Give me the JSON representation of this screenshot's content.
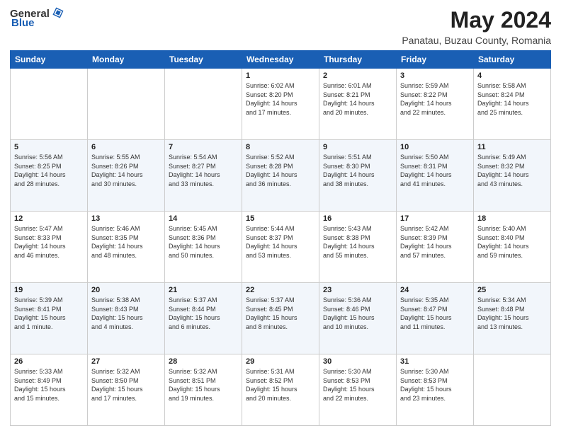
{
  "header": {
    "logo_general": "General",
    "logo_blue": "Blue",
    "title": "May 2024",
    "location": "Panatau, Buzau County, Romania"
  },
  "days_of_week": [
    "Sunday",
    "Monday",
    "Tuesday",
    "Wednesday",
    "Thursday",
    "Friday",
    "Saturday"
  ],
  "weeks": [
    [
      {
        "day": "",
        "info": ""
      },
      {
        "day": "",
        "info": ""
      },
      {
        "day": "",
        "info": ""
      },
      {
        "day": "1",
        "info": "Sunrise: 6:02 AM\nSunset: 8:20 PM\nDaylight: 14 hours\nand 17 minutes."
      },
      {
        "day": "2",
        "info": "Sunrise: 6:01 AM\nSunset: 8:21 PM\nDaylight: 14 hours\nand 20 minutes."
      },
      {
        "day": "3",
        "info": "Sunrise: 5:59 AM\nSunset: 8:22 PM\nDaylight: 14 hours\nand 22 minutes."
      },
      {
        "day": "4",
        "info": "Sunrise: 5:58 AM\nSunset: 8:24 PM\nDaylight: 14 hours\nand 25 minutes."
      }
    ],
    [
      {
        "day": "5",
        "info": "Sunrise: 5:56 AM\nSunset: 8:25 PM\nDaylight: 14 hours\nand 28 minutes."
      },
      {
        "day": "6",
        "info": "Sunrise: 5:55 AM\nSunset: 8:26 PM\nDaylight: 14 hours\nand 30 minutes."
      },
      {
        "day": "7",
        "info": "Sunrise: 5:54 AM\nSunset: 8:27 PM\nDaylight: 14 hours\nand 33 minutes."
      },
      {
        "day": "8",
        "info": "Sunrise: 5:52 AM\nSunset: 8:28 PM\nDaylight: 14 hours\nand 36 minutes."
      },
      {
        "day": "9",
        "info": "Sunrise: 5:51 AM\nSunset: 8:30 PM\nDaylight: 14 hours\nand 38 minutes."
      },
      {
        "day": "10",
        "info": "Sunrise: 5:50 AM\nSunset: 8:31 PM\nDaylight: 14 hours\nand 41 minutes."
      },
      {
        "day": "11",
        "info": "Sunrise: 5:49 AM\nSunset: 8:32 PM\nDaylight: 14 hours\nand 43 minutes."
      }
    ],
    [
      {
        "day": "12",
        "info": "Sunrise: 5:47 AM\nSunset: 8:33 PM\nDaylight: 14 hours\nand 46 minutes."
      },
      {
        "day": "13",
        "info": "Sunrise: 5:46 AM\nSunset: 8:35 PM\nDaylight: 14 hours\nand 48 minutes."
      },
      {
        "day": "14",
        "info": "Sunrise: 5:45 AM\nSunset: 8:36 PM\nDaylight: 14 hours\nand 50 minutes."
      },
      {
        "day": "15",
        "info": "Sunrise: 5:44 AM\nSunset: 8:37 PM\nDaylight: 14 hours\nand 53 minutes."
      },
      {
        "day": "16",
        "info": "Sunrise: 5:43 AM\nSunset: 8:38 PM\nDaylight: 14 hours\nand 55 minutes."
      },
      {
        "day": "17",
        "info": "Sunrise: 5:42 AM\nSunset: 8:39 PM\nDaylight: 14 hours\nand 57 minutes."
      },
      {
        "day": "18",
        "info": "Sunrise: 5:40 AM\nSunset: 8:40 PM\nDaylight: 14 hours\nand 59 minutes."
      }
    ],
    [
      {
        "day": "19",
        "info": "Sunrise: 5:39 AM\nSunset: 8:41 PM\nDaylight: 15 hours\nand 1 minute."
      },
      {
        "day": "20",
        "info": "Sunrise: 5:38 AM\nSunset: 8:43 PM\nDaylight: 15 hours\nand 4 minutes."
      },
      {
        "day": "21",
        "info": "Sunrise: 5:37 AM\nSunset: 8:44 PM\nDaylight: 15 hours\nand 6 minutes."
      },
      {
        "day": "22",
        "info": "Sunrise: 5:37 AM\nSunset: 8:45 PM\nDaylight: 15 hours\nand 8 minutes."
      },
      {
        "day": "23",
        "info": "Sunrise: 5:36 AM\nSunset: 8:46 PM\nDaylight: 15 hours\nand 10 minutes."
      },
      {
        "day": "24",
        "info": "Sunrise: 5:35 AM\nSunset: 8:47 PM\nDaylight: 15 hours\nand 11 minutes."
      },
      {
        "day": "25",
        "info": "Sunrise: 5:34 AM\nSunset: 8:48 PM\nDaylight: 15 hours\nand 13 minutes."
      }
    ],
    [
      {
        "day": "26",
        "info": "Sunrise: 5:33 AM\nSunset: 8:49 PM\nDaylight: 15 hours\nand 15 minutes."
      },
      {
        "day": "27",
        "info": "Sunrise: 5:32 AM\nSunset: 8:50 PM\nDaylight: 15 hours\nand 17 minutes."
      },
      {
        "day": "28",
        "info": "Sunrise: 5:32 AM\nSunset: 8:51 PM\nDaylight: 15 hours\nand 19 minutes."
      },
      {
        "day": "29",
        "info": "Sunrise: 5:31 AM\nSunset: 8:52 PM\nDaylight: 15 hours\nand 20 minutes."
      },
      {
        "day": "30",
        "info": "Sunrise: 5:30 AM\nSunset: 8:53 PM\nDaylight: 15 hours\nand 22 minutes."
      },
      {
        "day": "31",
        "info": "Sunrise: 5:30 AM\nSunset: 8:53 PM\nDaylight: 15 hours\nand 23 minutes."
      },
      {
        "day": "",
        "info": ""
      }
    ]
  ]
}
